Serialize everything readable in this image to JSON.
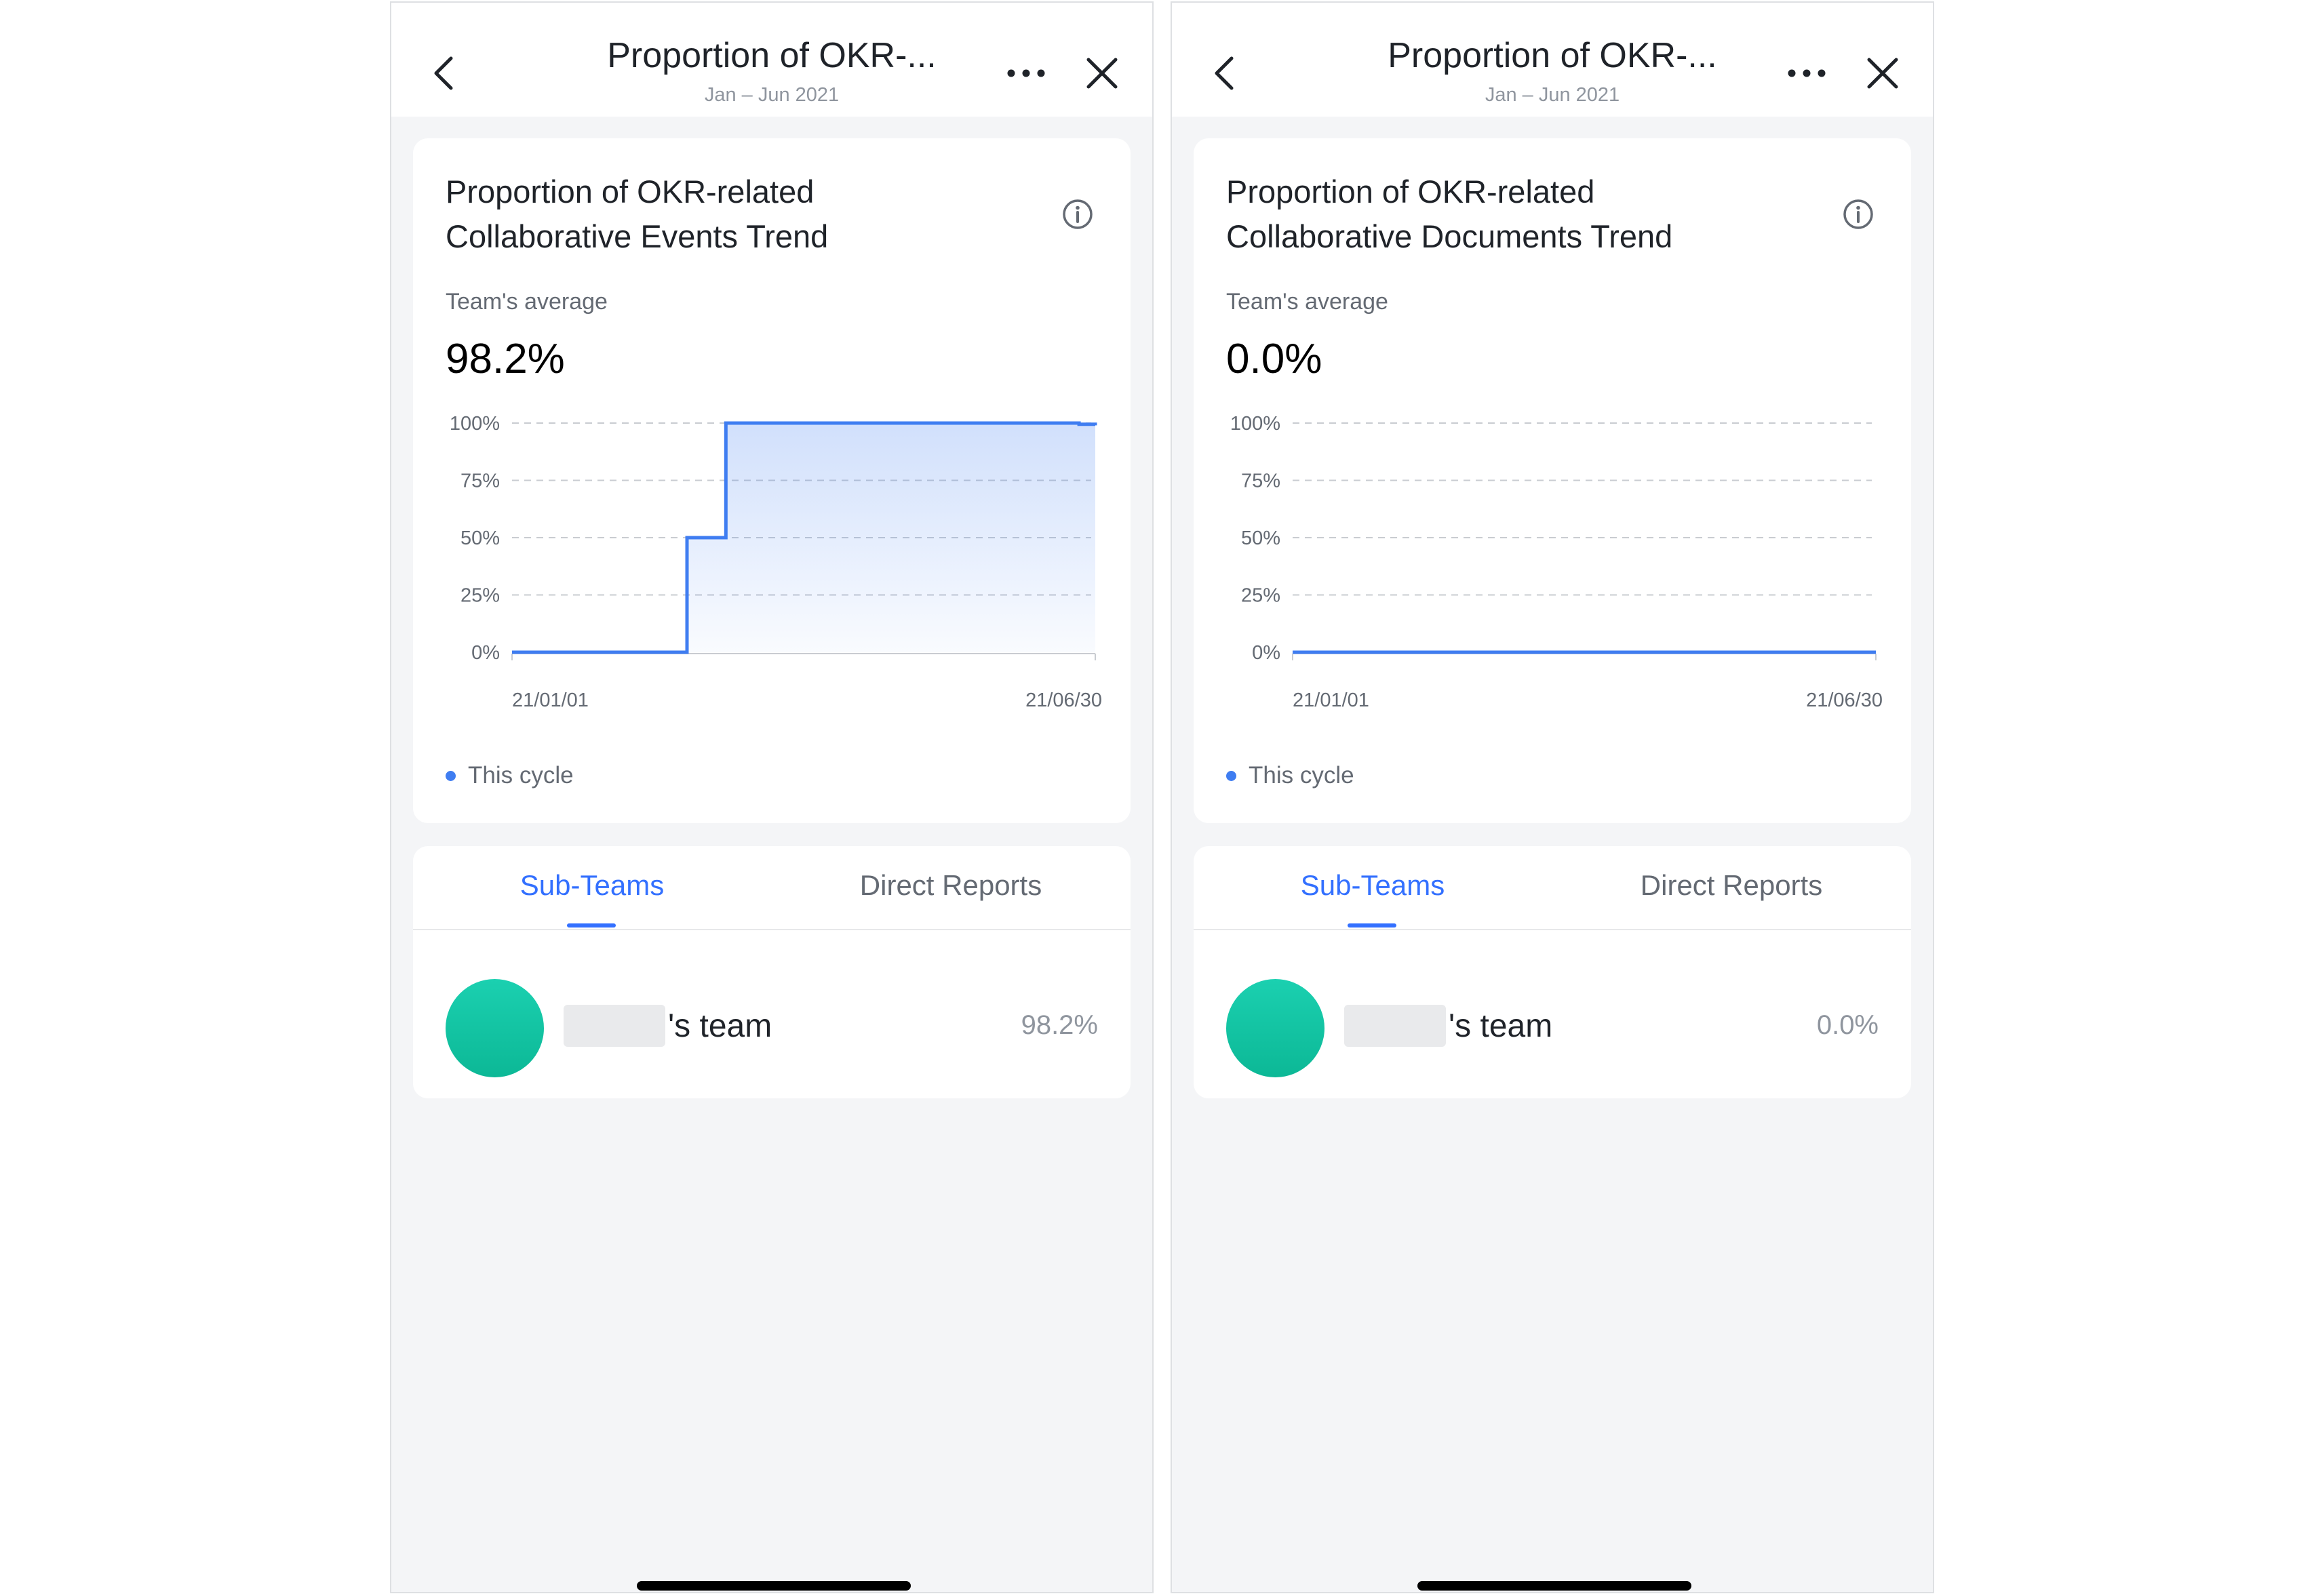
{
  "colors": {
    "accent": "#3370ff",
    "series_line": "#3f7df1",
    "avatar": "#12c6a4",
    "background": "#f4f5f7",
    "card": "#ffffff"
  },
  "icons": {
    "back": "chevron-left-icon",
    "more": "more-horizontal-icon",
    "close": "close-icon",
    "info": "info-icon"
  },
  "left": {
    "nav": {
      "title": "Proportion of OKR-...",
      "subtitle": "Jan – Jun 2021"
    },
    "card": {
      "title_line1": "Proportion of OKR-related",
      "title_line2": "Collaborative Events Trend",
      "avg_label": "Team's average",
      "avg_value": "98.2%"
    },
    "legend": "This cycle",
    "tabs": [
      "Sub-Teams",
      "Direct Reports"
    ],
    "row": {
      "name_suffix": "'s team",
      "value": "98.2%"
    }
  },
  "right": {
    "nav": {
      "title": "Proportion of OKR-...",
      "subtitle": "Jan – Jun 2021"
    },
    "card": {
      "title_line1": "Proportion of OKR-related",
      "title_line2": "Collaborative Documents Trend",
      "avg_label": "Team's average",
      "avg_value": "0.0%"
    },
    "legend": "This cycle",
    "tabs": [
      "Sub-Teams",
      "Direct Reports"
    ],
    "row": {
      "name_suffix": "'s team",
      "value": "0.0%"
    }
  },
  "chart_data": [
    {
      "type": "area",
      "title": "Proportion of OKR-related Collaborative Events Trend",
      "y_ticks": [
        "100%",
        "75%",
        "50%",
        "25%",
        "0%"
      ],
      "ylim": [
        0,
        100
      ],
      "x_tick_labels": [
        "21/01/01",
        "21/06/30"
      ],
      "grid": true,
      "legend": "bottom-left",
      "series": [
        {
          "name": "This cycle",
          "step": true,
          "x": [
            "2021-01-01",
            "2021-02-24",
            "2021-03-08",
            "2021-06-14",
            "2021-06-25",
            "2021-06-30"
          ],
          "values": [
            0,
            50,
            100,
            100,
            99.5,
            99
          ]
        }
      ]
    },
    {
      "type": "line",
      "title": "Proportion of OKR-related Collaborative Documents Trend",
      "y_ticks": [
        "100%",
        "75%",
        "50%",
        "25%",
        "0%"
      ],
      "ylim": [
        0,
        100
      ],
      "x_tick_labels": [
        "21/01/01",
        "21/06/30"
      ],
      "grid": true,
      "legend": "bottom-left",
      "series": [
        {
          "name": "This cycle",
          "x": [
            "2021-01-01",
            "2021-06-30"
          ],
          "values": [
            0,
            0
          ]
        }
      ]
    }
  ]
}
